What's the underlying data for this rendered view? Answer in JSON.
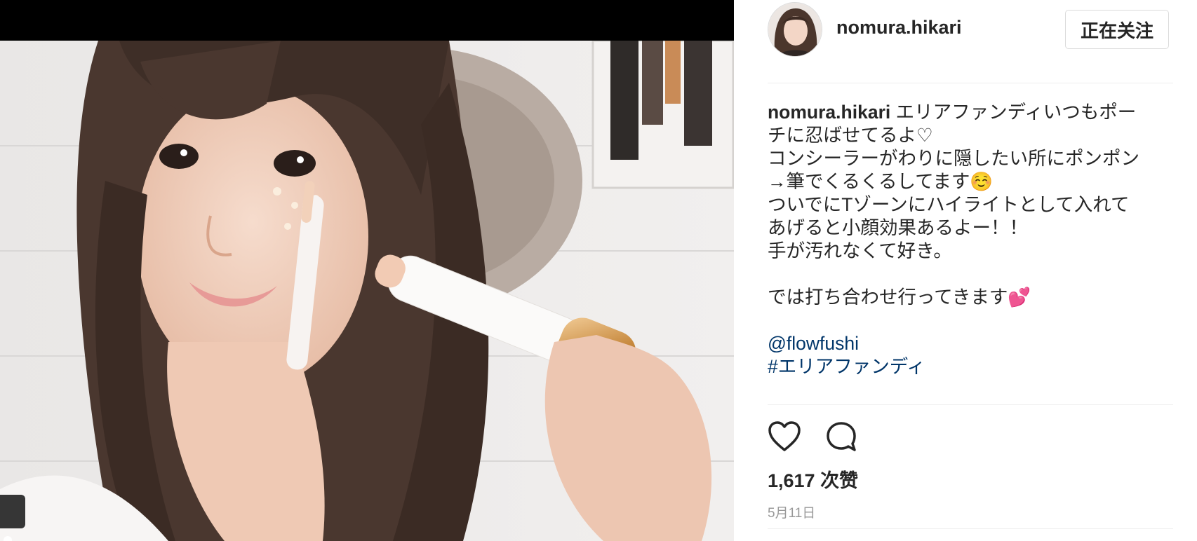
{
  "post": {
    "username": "nomura.hikari",
    "follow_label": "正在关注",
    "caption_lines": [
      "エリアファンディいつもポー",
      "チに忍ばせてるよ♡",
      "コンシーラーがわりに隠したい所にポンポン",
      "→筆でくるくるしてます☺️",
      "ついでにTゾーンにハイライトとして入れて",
      "あげると小顔効果あるよー！！",
      "手が汚れなくて好き。",
      "",
      "では打ち合わせ行ってきます💕",
      "",
      "@flowfushi",
      "#エリアファンディ"
    ],
    "mention": "@flowfushi",
    "hashtag": "#エリアファンディ",
    "likes": "1,617 次赞",
    "date": "5月11日"
  },
  "icons": {
    "like": "heart-icon",
    "comment": "comment-bubble-icon",
    "tag": "person-tag-icon"
  },
  "colors": {
    "link": "#003569",
    "text": "#262626",
    "muted": "#999999",
    "divider": "#efefef"
  }
}
